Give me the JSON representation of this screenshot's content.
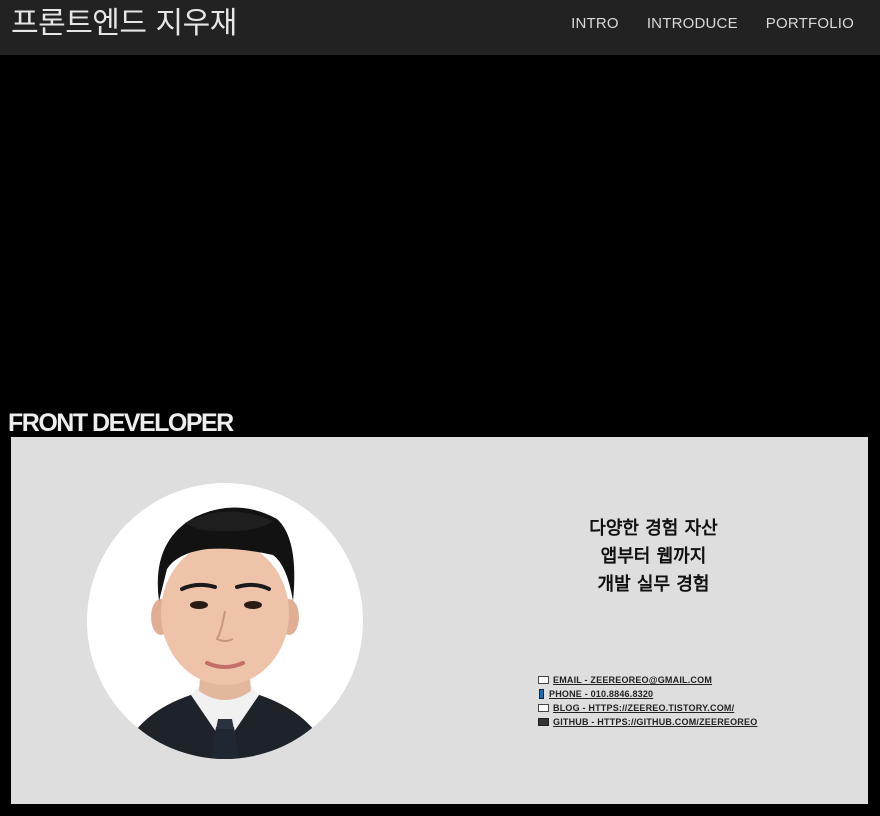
{
  "header": {
    "brand": "프론트엔드 지우재",
    "nav": [
      "INTRO",
      "INTRODUCE",
      "PORTFOLIO"
    ]
  },
  "hero": {
    "title": "FRONT DEVELOPER"
  },
  "profile": {
    "tagline": [
      "다양한 경험 자산",
      "앱부터 웹까지",
      "개발 실무 경험"
    ],
    "contacts": [
      {
        "icon": "envelope-icon",
        "text": "EMAIL - ZEEREOREO@GMAIL.COM"
      },
      {
        "icon": "phone-icon",
        "text": "PHONE - 010.8846.8320"
      },
      {
        "icon": "blog-icon",
        "text": "BLOG - HTTPS://ZEEREO.TISTORY.COM/"
      },
      {
        "icon": "laptop-icon",
        "text": "GITHUB - HTTPS://GITHUB.COM/ZEEREOREO"
      }
    ]
  },
  "colors": {
    "topbar": "#222222",
    "background": "#000000",
    "card": "#dedede"
  }
}
